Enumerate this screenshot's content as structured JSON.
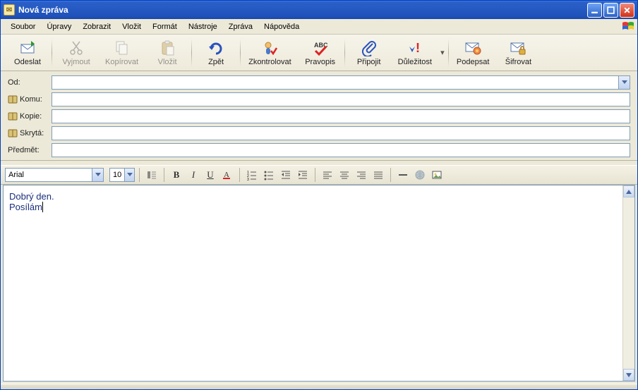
{
  "window": {
    "title": "Nová zpráva"
  },
  "menu": {
    "items": [
      "Soubor",
      "Úpravy",
      "Zobrazit",
      "Vložit",
      "Formát",
      "Nástroje",
      "Zpráva",
      "Nápověda"
    ]
  },
  "toolbar": {
    "send": "Odeslat",
    "cut": "Vyjmout",
    "copy": "Kopírovat",
    "paste": "Vložit",
    "undo": "Zpět",
    "spellcheck": "Zkontrolovat",
    "spelling": "Pravopis",
    "attach": "Připojit",
    "priority": "Důležitost",
    "sign": "Podepsat",
    "encrypt": "Šifrovat"
  },
  "fields": {
    "from": {
      "label": "Od:",
      "value": ""
    },
    "to": {
      "label": "Komu:",
      "value": ""
    },
    "cc": {
      "label": "Kopie:",
      "value": ""
    },
    "bcc": {
      "label": "Skrytá:",
      "value": ""
    },
    "subject": {
      "label": "Předmět:",
      "value": ""
    }
  },
  "format": {
    "font_name": "Arial",
    "font_size": "10"
  },
  "body": {
    "line1": "Dobrý den.",
    "line2": "Posílám"
  }
}
